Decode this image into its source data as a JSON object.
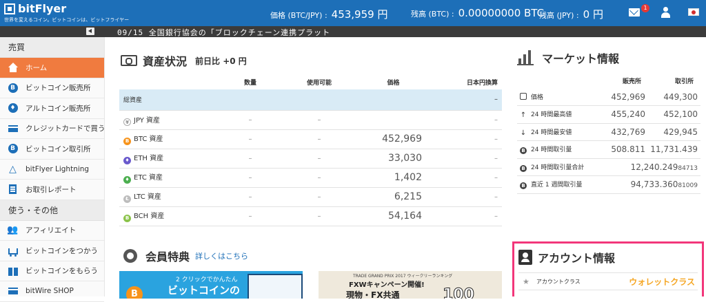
{
  "header": {
    "logo_name": "bitFlyer",
    "tagline": "世界を変えるコイン。ビットコインは、ビットフライヤー",
    "price_label": "価格 (BTC/JPY) :",
    "price_value": "453,959 円",
    "balance_btc_label": "残高 (BTC) :",
    "balance_btc_value": "0.00000000 BTC",
    "balance_jpy_label": "残高 (JPY) :",
    "balance_jpy_value": "0 円",
    "mail_badge": "1"
  },
  "ticker": {
    "text": "09/15 全国銀行協会の「ブロックチェーン連携プラット"
  },
  "sidebar": {
    "section1": "売買",
    "items1": [
      {
        "label": "ホーム",
        "icon": "home-icon"
      },
      {
        "label": "ビットコイン販売所",
        "icon": "bitcoin-icon"
      },
      {
        "label": "アルトコイン販売所",
        "icon": "ethereum-icon"
      },
      {
        "label": "クレジットカードで買う",
        "icon": "credit-card-icon"
      },
      {
        "label": "ビットコイン取引所",
        "icon": "bitcoin-icon"
      },
      {
        "label": "bitFlyer Lightning",
        "icon": "lightning-icon"
      },
      {
        "label": "お取引レポート",
        "icon": "report-icon"
      }
    ],
    "section2": "使う・その他",
    "items2": [
      {
        "label": "アフィリエイト",
        "icon": "affiliate-icon"
      },
      {
        "label": "ビットコインをつかう",
        "icon": "cart-icon"
      },
      {
        "label": "ビットコインをもらう",
        "icon": "gift-icon"
      },
      {
        "label": "bitWire SHOP",
        "icon": "shop-icon"
      }
    ]
  },
  "assets": {
    "title": "資産状況",
    "subtitle": "前日比 +0 円",
    "columns": [
      "数量",
      "使用可能",
      "価格",
      "日本円換算"
    ],
    "total_label": "総資産",
    "total_value": "–",
    "rows": [
      {
        "name": "JPY 資産",
        "qty": "–",
        "avail": "–",
        "price": "",
        "jpy": "–",
        "color": "#ffffff",
        "mark": "¥"
      },
      {
        "name": "BTC 資産",
        "qty": "–",
        "avail": "–",
        "price": "452,969",
        "jpy": "–",
        "color": "#f7931a",
        "mark": "B"
      },
      {
        "name": "ETH 資産",
        "qty": "–",
        "avail": "–",
        "price": "33,030",
        "jpy": "–",
        "color": "#6a5acd",
        "mark": "♦"
      },
      {
        "name": "ETC 資産",
        "qty": "–",
        "avail": "–",
        "price": "1,402",
        "jpy": "–",
        "color": "#4caf50",
        "mark": "♦"
      },
      {
        "name": "LTC 資産",
        "qty": "–",
        "avail": "–",
        "price": "6,215",
        "jpy": "–",
        "color": "#bdbdbd",
        "mark": "Ł"
      },
      {
        "name": "BCH 資産",
        "qty": "–",
        "avail": "–",
        "price": "54,164",
        "jpy": "–",
        "color": "#8bc34a",
        "mark": "B"
      }
    ]
  },
  "benefits": {
    "title": "会員特典",
    "link": "詳しくはこちら",
    "banner1_line1": "2 クリックでかんたん",
    "banner1_line2": "ビットコインの",
    "banner2_line1": "TRADE GRAND PRIX 2017 ウィークリーランキング",
    "banner2_line2": "FXWキャンペーン開催!",
    "banner2_line3": "現物・FX共通",
    "banner2_num": "100"
  },
  "market": {
    "title": "マーケット情報",
    "columns": [
      "販売所",
      "取引所"
    ],
    "rows": [
      {
        "label": "価格",
        "icon": "price-tag-icon",
        "sell": "452,969",
        "exch": "449,300"
      },
      {
        "label": "24 時間最高値",
        "icon": "arrow-up-icon",
        "sell": "455,240",
        "exch": "452,100"
      },
      {
        "label": "24 時間最安値",
        "icon": "arrow-down-icon",
        "sell": "432,769",
        "exch": "429,945"
      },
      {
        "label": "24 時間取引量",
        "icon": "bitcoin-icon",
        "sell": "508.811",
        "exch": "11,731.439"
      }
    ],
    "total24_label": "24 時間取引量合計",
    "total24_main": "12,240.249",
    "total24_small": "84713",
    "week_label": "直近 1 週間取引量",
    "week_main": "94,733.360",
    "week_small": "81009"
  },
  "account": {
    "title": "アカウント情報",
    "class_label": "アカウントクラス",
    "class_value": "ウォレットクラス"
  },
  "colors": {
    "brand_blue": "#1d6fb8",
    "active_orange": "#f07b3f",
    "highlight_pink": "#f2367a",
    "wallet_orange": "#f5a623"
  }
}
